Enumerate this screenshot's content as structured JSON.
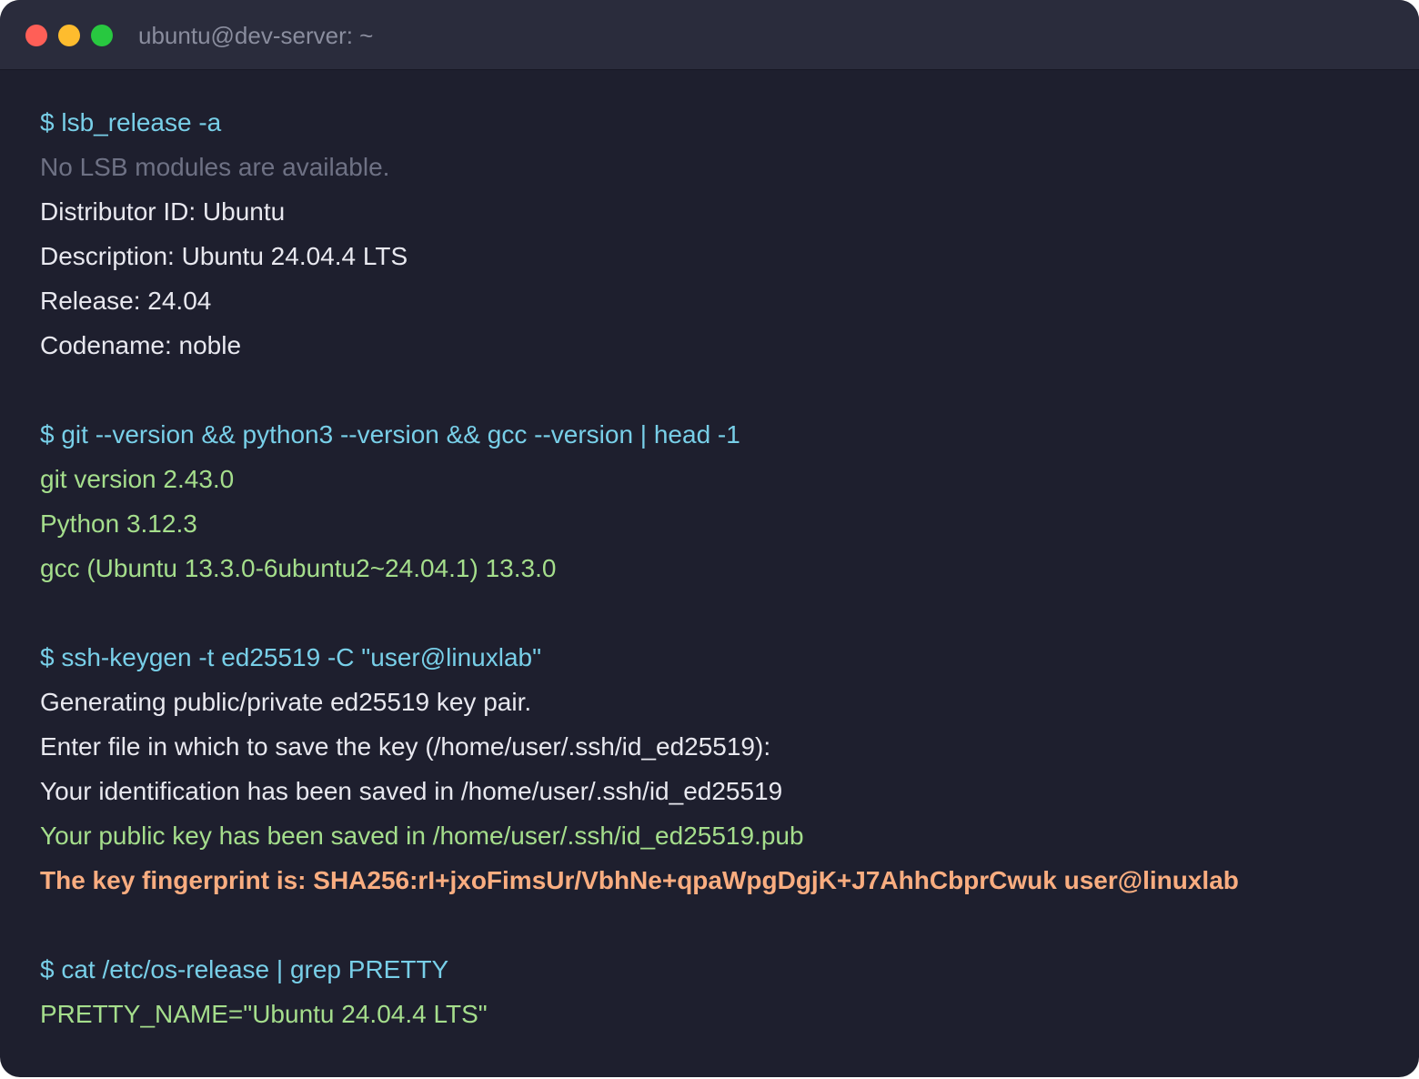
{
  "window": {
    "title": "ubuntu@dev-server: ~",
    "colors": {
      "background": "#1e1f2e",
      "titlebar": "#2a2c3c",
      "close": "#ff5f57",
      "minimize": "#febc2e",
      "zoom": "#28c840"
    }
  },
  "terminal": {
    "colors": {
      "command": "#78cfe8",
      "muted": "#6e7184",
      "output": "#e8e8ef",
      "success": "#a5de8c",
      "highlight": "#f9ad80"
    },
    "lines": [
      "$ lsb_release -a",
      "No LSB modules are available.",
      "Distributor ID: Ubuntu",
      "Description: Ubuntu 24.04.4 LTS",
      "Release: 24.04",
      "Codename: noble",
      "",
      "$ git --version && python3 --version && gcc --version | head -1",
      "git version 2.43.0",
      "Python 3.12.3",
      "gcc (Ubuntu 13.3.0-6ubuntu2~24.04.1) 13.3.0",
      "",
      "$ ssh-keygen -t ed25519 -C \"user@linuxlab\"",
      "Generating public/private ed25519 key pair.",
      "Enter file in which to save the key (/home/user/.ssh/id_ed25519):",
      "Your identification has been saved in /home/user/.ssh/id_ed25519",
      "Your public key has been saved in /home/user/.ssh/id_ed25519.pub",
      "The key fingerprint is: SHA256:rI+jxoFimsUr/VbhNe+qpaWpgDgjK+J7AhhCbprCwuk user@linuxlab",
      "",
      "$ cat /etc/os-release | grep PRETTY",
      "PRETTY_NAME=\"Ubuntu 24.04.4 LTS\""
    ]
  }
}
